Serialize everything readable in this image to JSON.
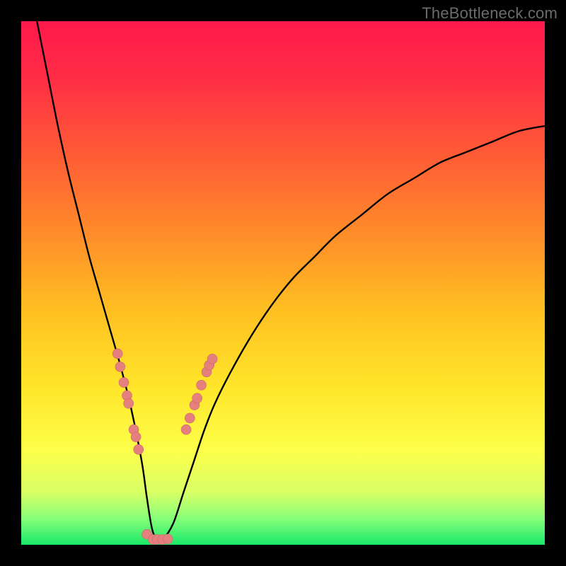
{
  "watermark": "TheBottleneck.com",
  "colors": {
    "gradient_stops": [
      {
        "offset": 0.0,
        "color": "#ff1a4b"
      },
      {
        "offset": 0.1,
        "color": "#ff2b46"
      },
      {
        "offset": 0.25,
        "color": "#ff5a36"
      },
      {
        "offset": 0.4,
        "color": "#ff8a2a"
      },
      {
        "offset": 0.55,
        "color": "#ffbf22"
      },
      {
        "offset": 0.7,
        "color": "#ffe62a"
      },
      {
        "offset": 0.82,
        "color": "#fdff4a"
      },
      {
        "offset": 0.9,
        "color": "#d8ff66"
      },
      {
        "offset": 0.95,
        "color": "#86ff7a"
      },
      {
        "offset": 1.0,
        "color": "#19e868"
      }
    ],
    "curve": "#000000",
    "marker_fill": "#e6807f",
    "marker_stroke": "#c86a69"
  },
  "chart_data": {
    "type": "line",
    "title": "",
    "xlabel": "",
    "ylabel": "",
    "xlim": [
      0,
      100
    ],
    "ylim": [
      0,
      100
    ],
    "series": [
      {
        "name": "bottleneck-curve",
        "x": [
          3,
          5,
          7,
          9,
          11,
          13,
          15,
          17,
          19,
          21,
          23,
          24,
          25,
          26,
          27,
          29,
          31,
          33,
          35,
          37,
          40,
          44,
          48,
          52,
          56,
          60,
          65,
          70,
          75,
          80,
          85,
          90,
          95,
          100
        ],
        "y": [
          100,
          90,
          80,
          71,
          63,
          55,
          48,
          41,
          34,
          26,
          16,
          9,
          3,
          1,
          1,
          4,
          10,
          16,
          22,
          27,
          33,
          40,
          46,
          51,
          55,
          59,
          63,
          67,
          70,
          73,
          75,
          77,
          79,
          80
        ]
      }
    ],
    "markers": [
      {
        "x": 18.4,
        "y": 36.5
      },
      {
        "x": 18.9,
        "y": 34.0
      },
      {
        "x": 19.6,
        "y": 31.0
      },
      {
        "x": 20.2,
        "y": 28.5
      },
      {
        "x": 20.5,
        "y": 27.0
      },
      {
        "x": 21.5,
        "y": 22.0
      },
      {
        "x": 21.9,
        "y": 20.6
      },
      {
        "x": 22.4,
        "y": 18.2
      },
      {
        "x": 24.0,
        "y": 2.0
      },
      {
        "x": 25.2,
        "y": 1.0
      },
      {
        "x": 26.0,
        "y": 1.0
      },
      {
        "x": 27.0,
        "y": 1.0
      },
      {
        "x": 28.0,
        "y": 1.1
      },
      {
        "x": 31.5,
        "y": 22.0
      },
      {
        "x": 32.2,
        "y": 24.2
      },
      {
        "x": 33.1,
        "y": 26.7
      },
      {
        "x": 33.6,
        "y": 28.0
      },
      {
        "x": 34.4,
        "y": 30.5
      },
      {
        "x": 35.4,
        "y": 33.0
      },
      {
        "x": 35.9,
        "y": 34.3
      },
      {
        "x": 36.5,
        "y": 35.5
      }
    ]
  }
}
